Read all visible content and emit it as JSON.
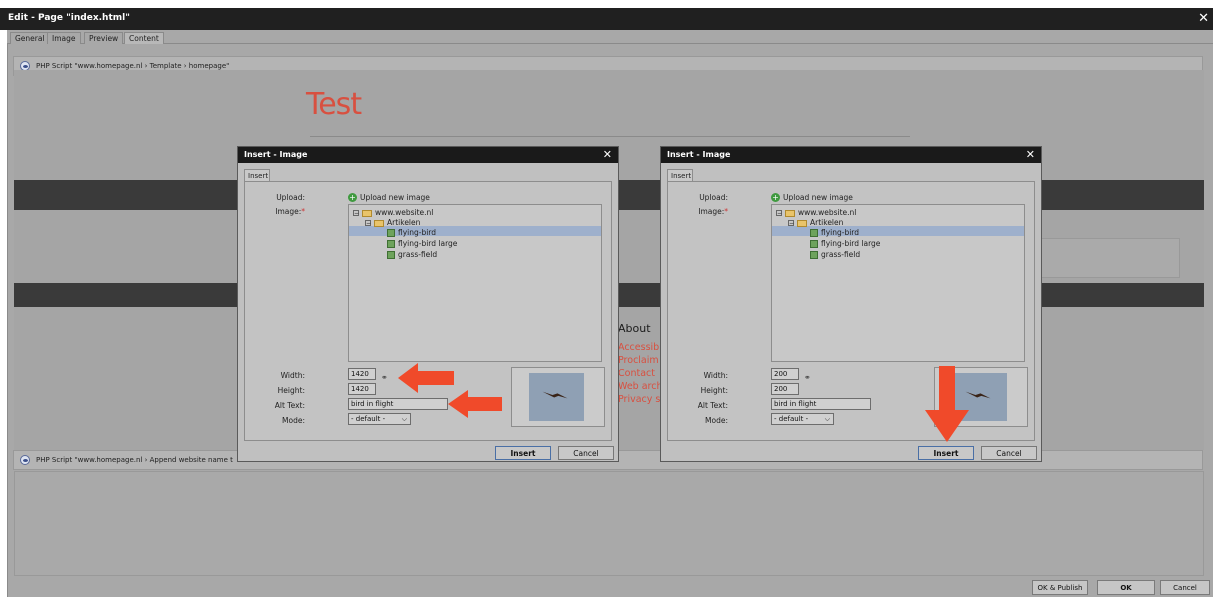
{
  "window": {
    "title": "Edit - Page \"index.html\"",
    "close_glyph": "✕",
    "tabs": [
      "General",
      "Image",
      "Preview",
      "Content"
    ]
  },
  "content": {
    "php_top": "PHP Script \"www.homepage.nl › Template › homepage\"",
    "php_bottom": "PHP Script \"www.homepage.nl › Append website name t",
    "heading": "Test",
    "about": "About",
    "links": [
      "Accessibi",
      "Proclaim",
      "Contact",
      "Web arch",
      "Privacy s"
    ]
  },
  "dialog_left": {
    "title": "Insert - Image",
    "tab": "Insert",
    "upload_label": "Upload:",
    "upload_link": "Upload new image",
    "image_label": "Image:",
    "required_mark": "*",
    "tree": {
      "root": "www.website.nl",
      "folder": "Artikelen",
      "files": [
        "flying-bird",
        "flying-bird large",
        "grass-field"
      ],
      "selected": "flying-bird"
    },
    "width_label": "Width:",
    "width_value": "1420",
    "height_label": "Height:",
    "height_value": "1420",
    "alt_label": "Alt Text:",
    "alt_value": "bird in flight",
    "mode_label": "Mode:",
    "mode_value": "- default -",
    "insert_btn": "Insert",
    "cancel_btn": "Cancel"
  },
  "dialog_right": {
    "title": "Insert - Image",
    "tab": "Insert",
    "upload_label": "Upload:",
    "upload_link": "Upload new image",
    "image_label": "Image:",
    "required_mark": "*",
    "tree": {
      "root": "www.website.nl",
      "folder": "Artikelen",
      "files": [
        "flying-bird",
        "flying-bird large",
        "grass-field"
      ],
      "selected": "flying-bird"
    },
    "width_label": "Width:",
    "width_value": "200",
    "height_label": "Height:",
    "height_value": "200",
    "alt_label": "Alt Text:",
    "alt_value": "bird in flight",
    "mode_label": "Mode:",
    "mode_value": "- default -",
    "insert_btn": "Insert",
    "cancel_btn": "Cancel"
  },
  "footer": {
    "ok_publish": "OK & Publish",
    "ok": "OK",
    "cancel": "Cancel"
  },
  "colors": {
    "accent_red": "#d85040",
    "arrow_red": "#f04a2a",
    "selection_blue": "#9eb0cc"
  }
}
